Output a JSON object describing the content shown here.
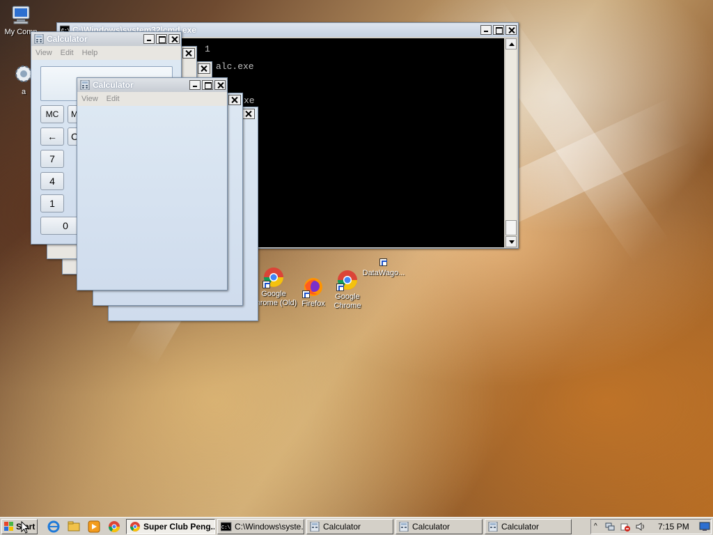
{
  "desktop": {
    "icons": [
      {
        "label": "My Comp",
        "icon": "computer-icon"
      },
      {
        "label": "a",
        "icon": "settings-gear-icon"
      },
      {
        "label": "Google Chrome (Old)",
        "icon": "chrome-icon"
      },
      {
        "label": "Firefox",
        "icon": "firefox-icon"
      },
      {
        "label": "Google Chrome",
        "icon": "chrome-icon"
      },
      {
        "label": "DataWago...",
        "icon": "datawagon-icon"
      }
    ]
  },
  "cmd_window": {
    "title": "C:\\Windows\\system32\\cmd.exe",
    "lines": [
      "1",
      "alc.exe",
      "xe"
    ]
  },
  "calc_front": {
    "title": "Calculator",
    "menu": [
      "View",
      "Edit",
      "Help"
    ],
    "buttons": [
      "MC",
      "M",
      "←",
      "C",
      "7",
      "4",
      "1",
      "0"
    ]
  },
  "calc_blank": {
    "title": "Calculator",
    "menu": [
      "View",
      "Edit"
    ]
  },
  "taskbar": {
    "start_label": "Start",
    "tasks": [
      {
        "label": "Super Club Peng...",
        "icon": "chrome-icon",
        "active": true
      },
      {
        "label": "C:\\Windows\\syste...",
        "icon": "cmd-icon",
        "active": false
      },
      {
        "label": "Calculator",
        "icon": "calculator-icon",
        "active": false
      },
      {
        "label": "Calculator",
        "icon": "calculator-icon",
        "active": false
      },
      {
        "label": "Calculator",
        "icon": "calculator-icon",
        "active": false
      }
    ],
    "clock": "7:15 PM"
  },
  "colors": {
    "taskbar_bg": "#d4d0c8",
    "titlebar_blue": "#c6d2e2",
    "console_bg": "#000000"
  }
}
